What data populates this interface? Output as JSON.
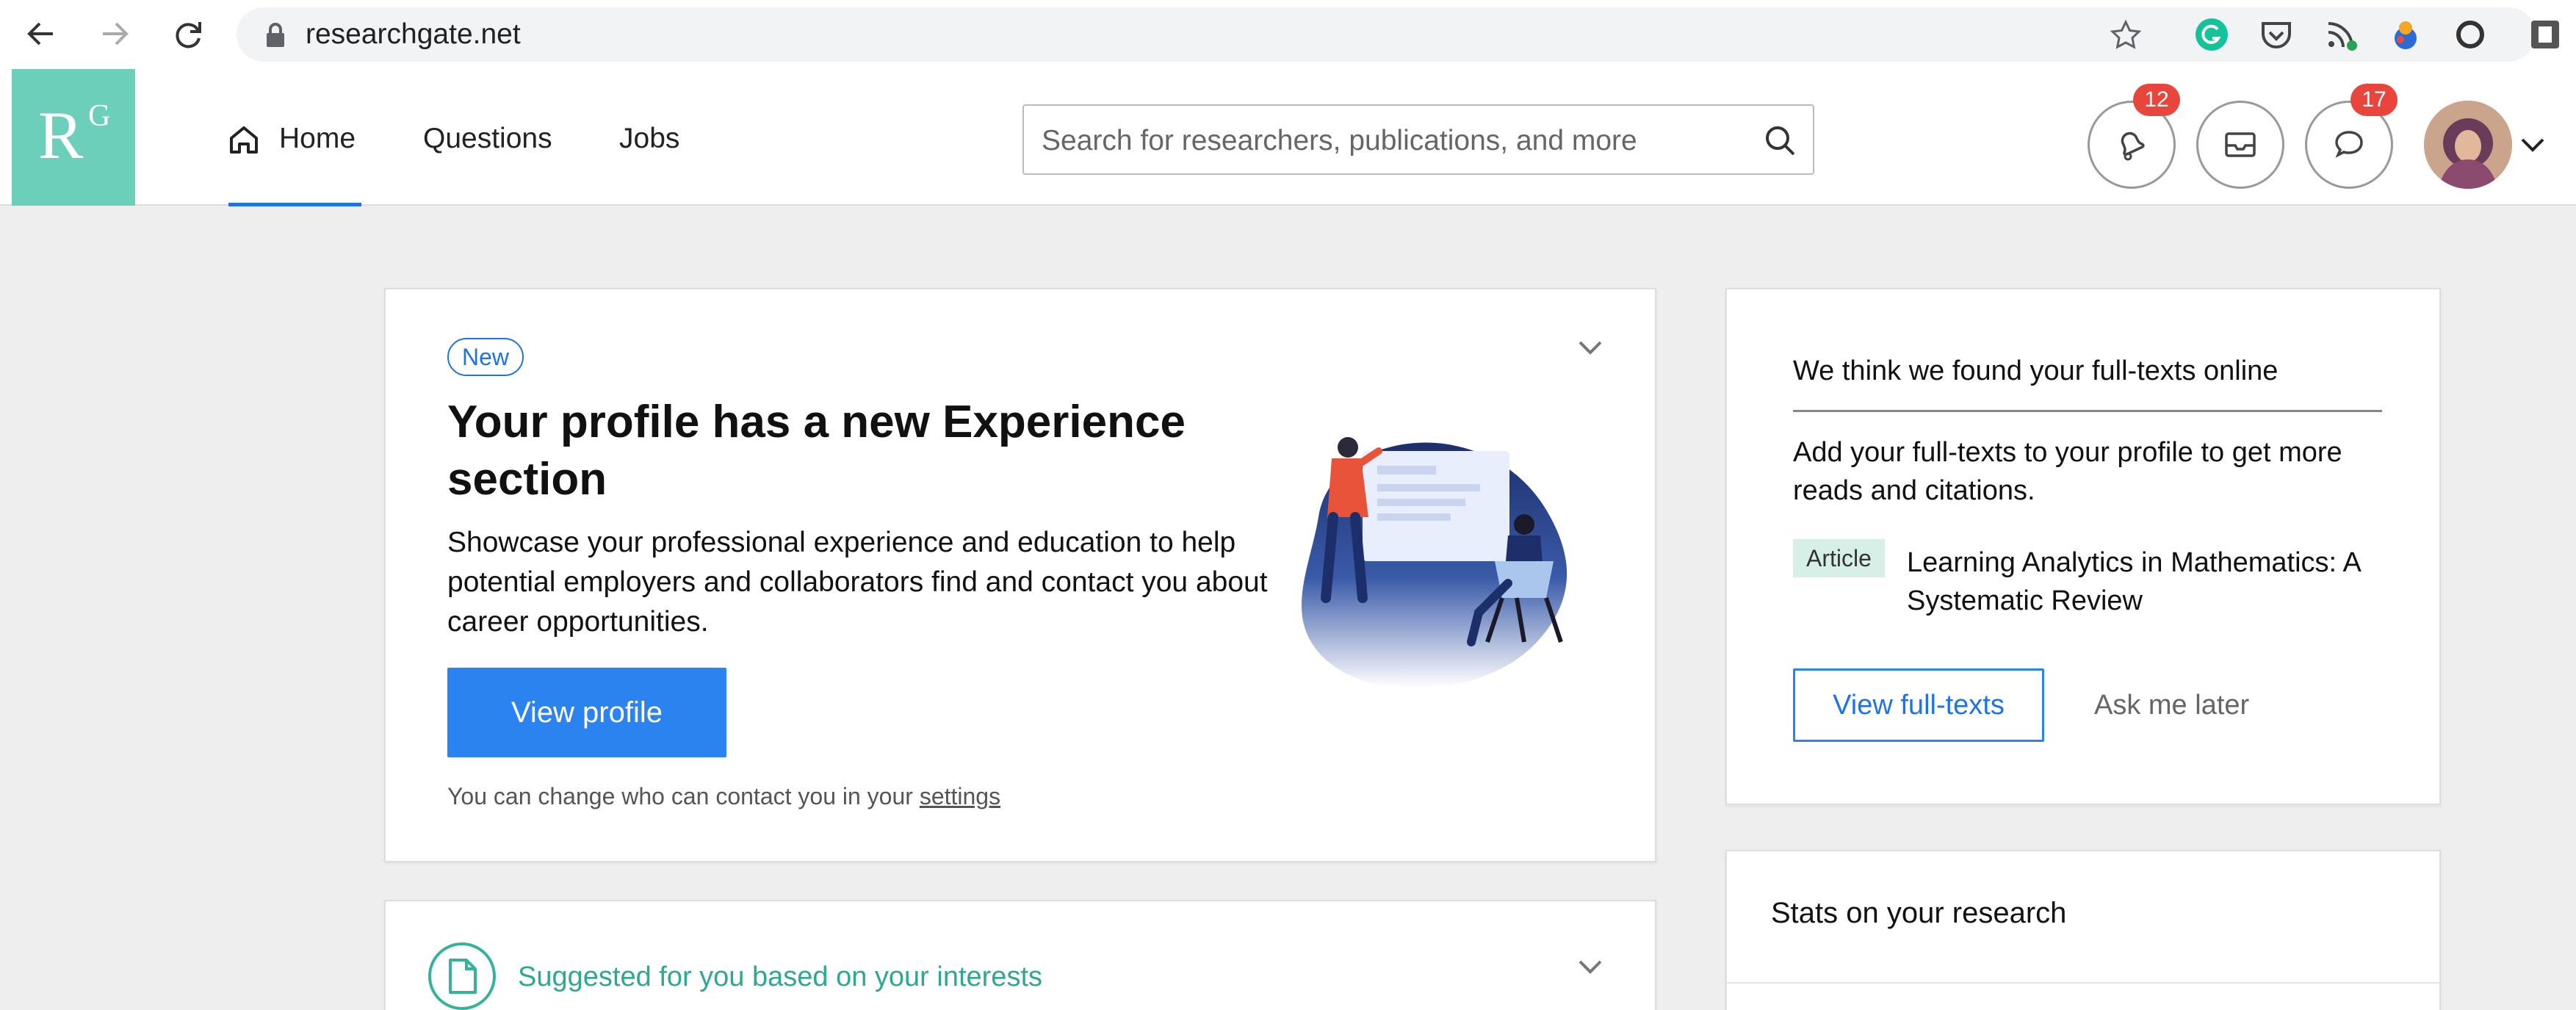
{
  "browser": {
    "url": "researchgate.net"
  },
  "header": {
    "logo_letter": "R",
    "logo_superscript": "G",
    "tabs": [
      {
        "label": "Home"
      },
      {
        "label": "Questions"
      },
      {
        "label": "Jobs"
      }
    ],
    "search_placeholder": "Search for researchers, publications, and more",
    "notifications_count": "12",
    "messages_count": "17"
  },
  "hero_card": {
    "pill": "New",
    "title": "Your profile has a new Experience section",
    "body": "Showcase your professional experience and education to help potential employers and collaborators find and contact you about career opportunities.",
    "button": "View profile",
    "footnote_prefix": "You can change who can contact you in your ",
    "footnote_link": "settings"
  },
  "fulltext_card": {
    "title": "We think we found your full-texts online",
    "body": "Add your full-texts to your profile to get more reads and citations.",
    "tag": "Article",
    "article_title": "Learning Analytics in Mathematics: A Systematic Review",
    "primary_button": "View full-texts",
    "secondary_button": "Ask me later"
  },
  "stats_card": {
    "title": "Stats on your research"
  },
  "suggested_card": {
    "title": "Suggested for you based on your interests"
  },
  "colors": {
    "brand": "#6ccfb9",
    "accent": "#2b83f0",
    "badge": "#e8453c",
    "teal_text": "#2ea88f"
  }
}
